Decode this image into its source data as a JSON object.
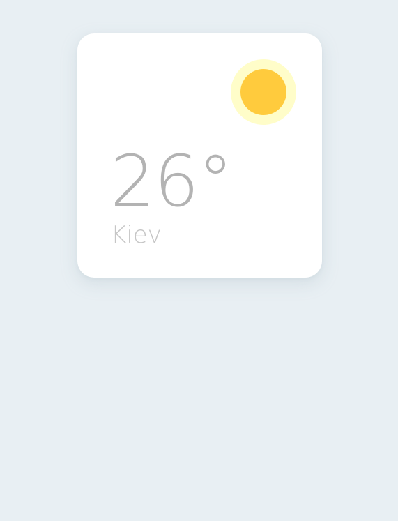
{
  "weather": {
    "temperature": "26°",
    "city": "Kiev",
    "condition_icon": "sun-icon"
  },
  "colors": {
    "background": "#e8eff3",
    "card": "#ffffff",
    "sun_core": "#ffcb3d",
    "sun_glow": "#fffdc9",
    "temperature_text": "#b3b3b3",
    "city_text": "#c6c6c6"
  }
}
